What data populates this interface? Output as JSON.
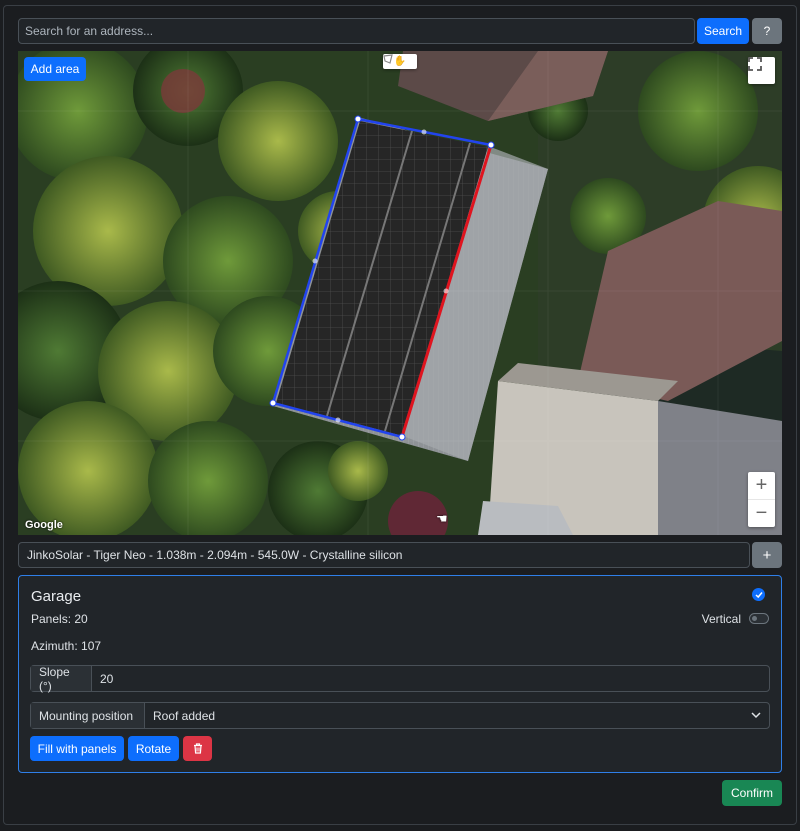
{
  "search": {
    "placeholder": "Search for an address...",
    "button": "Search",
    "help": "?"
  },
  "map": {
    "add_area": "Add area",
    "attribution": "Google",
    "zoom_in": "+",
    "zoom_out": "−",
    "icons": [
      "hand-icon",
      "polygon-draw-icon",
      "fullscreen-icon"
    ]
  },
  "panel_model": {
    "value": "JinkoSolar - Tiger Neo - 1.038m - 2.094m - 545.0W - Crystalline silicon",
    "add": "+"
  },
  "area": {
    "name": "Garage",
    "panels_label": "Panels: 20",
    "vertical_label": "Vertical",
    "vertical_on": false,
    "azimuth_label": "Azimuth: 107",
    "slope_label": "Slope (°)",
    "slope_value": "20",
    "mounting_label": "Mounting position",
    "mounting_value": "Roof added",
    "fill_button": "Fill with panels",
    "rotate_button": "Rotate"
  },
  "confirm": "Confirm",
  "colors": {
    "primary": "#0d6efd",
    "success": "#198754",
    "danger": "#dc3545",
    "polygon_edge": "#2244ee",
    "ridge_edge": "#e0141e"
  }
}
